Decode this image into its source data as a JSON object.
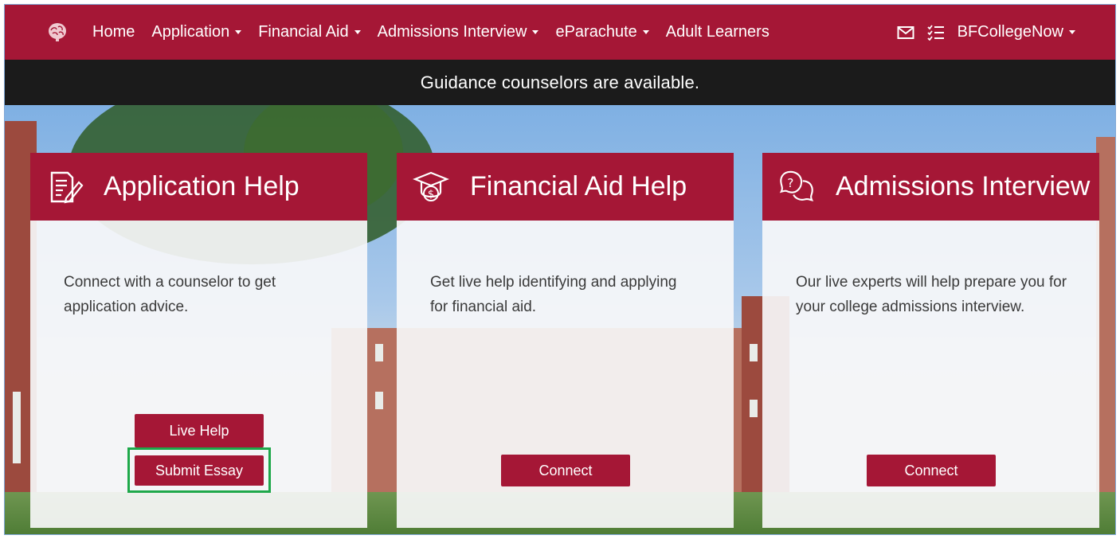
{
  "navbar": {
    "brand_icon": "brain-icon",
    "items": [
      {
        "label": "Home",
        "dropdown": false
      },
      {
        "label": "Application",
        "dropdown": true
      },
      {
        "label": "Financial Aid",
        "dropdown": true
      },
      {
        "label": "Admissions Interview",
        "dropdown": true
      },
      {
        "label": "eParachute",
        "dropdown": true
      },
      {
        "label": "Adult Learners",
        "dropdown": false
      }
    ],
    "right": {
      "mail_icon": "envelope-icon",
      "list_icon": "checklist-icon",
      "user_label": "BFCollegeNow"
    }
  },
  "banner": {
    "text": "Guidance counselors are available."
  },
  "cards": [
    {
      "icon": "document-pen-icon",
      "title": "Application Help",
      "body": "Connect with a counselor to get application advice.",
      "buttons": [
        "Live Help",
        "Submit Essay"
      ]
    },
    {
      "icon": "graduation-dollar-icon",
      "title": "Financial Aid Help",
      "body": "Get live help identifying and applying for financial aid.",
      "buttons": [
        "Connect"
      ]
    },
    {
      "icon": "question-chat-icon",
      "title": "Admissions Interview",
      "body": "Our live experts will help prepare you for your college admissions interview.",
      "buttons": [
        "Connect"
      ]
    }
  ],
  "colors": {
    "brand": "#a51736",
    "banner": "#1b1b1b",
    "focus_ring": "#1ea84a"
  }
}
